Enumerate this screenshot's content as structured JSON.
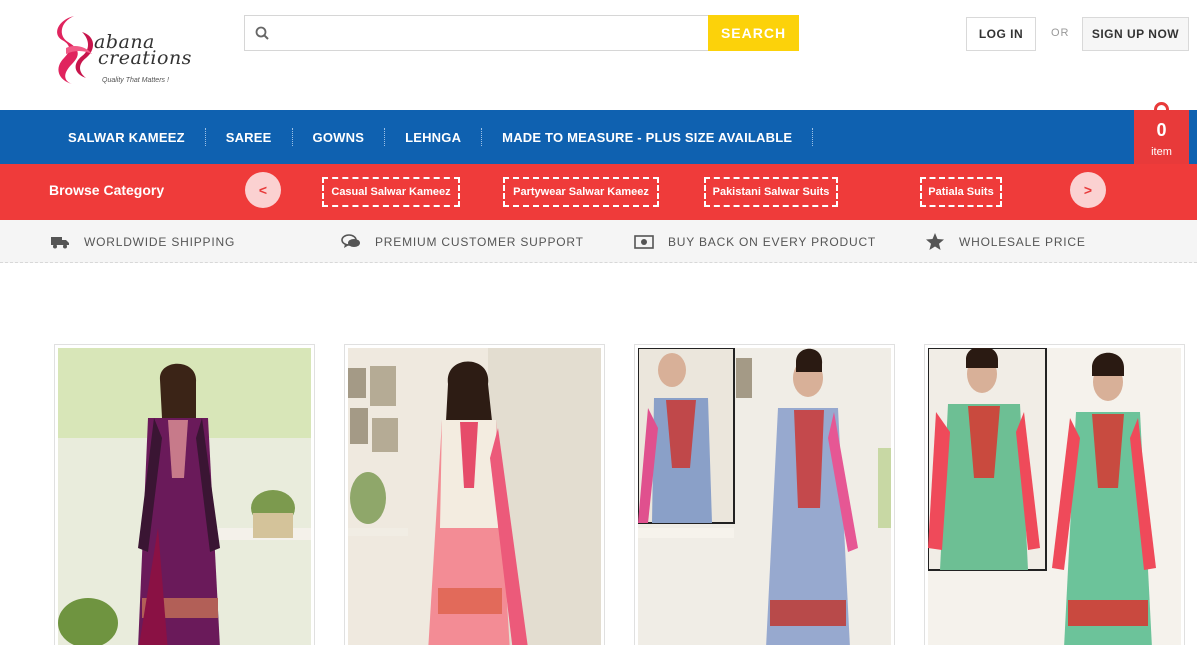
{
  "header": {
    "logo": {
      "line1": "abana",
      "line2": "creations",
      "tagline": "Quality That Matters !"
    },
    "search": {
      "placeholder": "",
      "button_label": "SEARCH"
    },
    "login_label": "LOG IN",
    "or_label": "OR",
    "signup_label": "SIGN UP NOW"
  },
  "nav": {
    "items": [
      {
        "label": "SALWAR KAMEEZ"
      },
      {
        "label": "SAREE"
      },
      {
        "label": "GOWNS"
      },
      {
        "label": "LEHNGA"
      },
      {
        "label": "MADE TO MEASURE - PLUS SIZE AVAILABLE"
      }
    ],
    "cart": {
      "count": "0",
      "label": "item"
    }
  },
  "categories": {
    "title": "Browse Category",
    "prev_label": "<",
    "next_label": ">",
    "items": [
      {
        "label": "Casual Salwar Kameez"
      },
      {
        "label": "Partywear Salwar Kameez"
      },
      {
        "label": "Pakistani Salwar Suits"
      },
      {
        "label": "Patiala Suits"
      }
    ]
  },
  "features": [
    {
      "icon": "truck-icon",
      "label": "WORLDWIDE SHIPPING"
    },
    {
      "icon": "chat-icon",
      "label": "PREMIUM CUSTOMER SUPPORT"
    },
    {
      "icon": "money-icon",
      "label": "BUY BACK ON EVERY PRODUCT"
    },
    {
      "icon": "star-icon",
      "label": "WHOLESALE PRICE"
    }
  ],
  "colors": {
    "nav_blue": "#0f61b0",
    "category_red": "#ef3b3a",
    "cart_red": "#e83a3a",
    "search_yellow": "#fcd20a",
    "logo_pink": "#e0245e"
  }
}
